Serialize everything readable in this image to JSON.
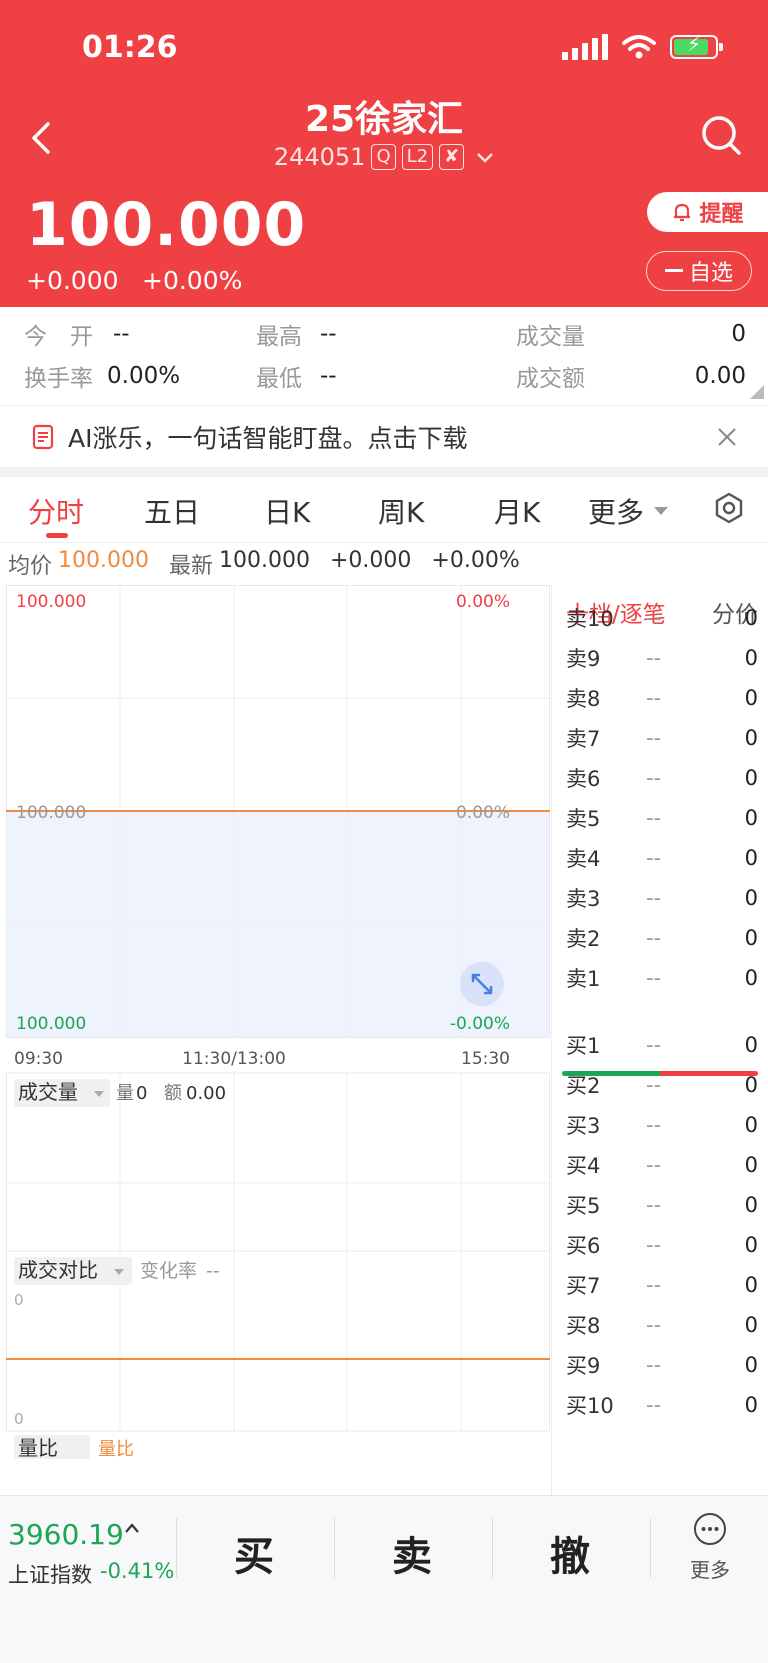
{
  "status": {
    "time": "01:26"
  },
  "stock": {
    "name": "25徐家汇",
    "code": "244051",
    "tag_q": "Q",
    "tag_l2": "L2",
    "tag_x": "✘",
    "price": "100.000",
    "change": "+0.000",
    "change_pct": "+0.00%"
  },
  "header": {
    "remind": "提醒",
    "watchlist": "自选"
  },
  "stats": [
    {
      "label": "今　开",
      "value": "--"
    },
    {
      "label": "最高",
      "value": "--"
    },
    {
      "label": "成交量",
      "value": "0"
    },
    {
      "label": "换手率",
      "value": "0.00%"
    },
    {
      "label": "最低",
      "value": "--"
    },
    {
      "label": "成交额",
      "value": "0.00"
    }
  ],
  "banner": {
    "text": "AI涨乐，一句话智能盯盘。点击下载"
  },
  "tabs": [
    "分时",
    "五日",
    "日K",
    "周K",
    "月K",
    "更多"
  ],
  "quote_line": {
    "avg_label": "均价",
    "avg_value": "100.000",
    "last_label": "最新",
    "last_value": "100.000",
    "change": "+0.000",
    "change_pct": "+0.00%"
  },
  "chart_data": {
    "type": "line",
    "price_axis": {
      "top": "100.000",
      "middle": "100.000",
      "bottom": "100.000"
    },
    "pct_axis": {
      "top": "0.00%",
      "middle": "0.00%",
      "bottom": "-0.00%"
    },
    "time_labels": [
      "09:30",
      "11:30/13:00",
      "15:30"
    ],
    "series": [
      {
        "values": [
          100.0
        ]
      }
    ],
    "ylim": [
      100.0,
      100.0
    ],
    "volume": {
      "selector": "成交量",
      "vol_label": "量",
      "vol_value": "0",
      "amt_label": "额",
      "amt_value": "0.00"
    },
    "ratio": {
      "selector": "成交对比",
      "rate_label": "变化率",
      "rate_value": "--",
      "axis_top": "0",
      "axis_bottom": "0"
    },
    "third_panel": {
      "selector": "量比",
      "label": "量比"
    },
    "colors": {
      "line": "#f08a3c",
      "area": "#eef3fd",
      "up": "#ef4044",
      "down": "#1aa655"
    }
  },
  "orderbook": {
    "tab_active": "十档/逐笔",
    "tab_other": "分价",
    "sell": [
      {
        "label": "卖10",
        "price": "--",
        "vol": "0"
      },
      {
        "label": "卖9",
        "price": "--",
        "vol": "0"
      },
      {
        "label": "卖8",
        "price": "--",
        "vol": "0"
      },
      {
        "label": "卖7",
        "price": "--",
        "vol": "0"
      },
      {
        "label": "卖6",
        "price": "--",
        "vol": "0"
      },
      {
        "label": "卖5",
        "price": "--",
        "vol": "0"
      },
      {
        "label": "卖4",
        "price": "--",
        "vol": "0"
      },
      {
        "label": "卖3",
        "price": "--",
        "vol": "0"
      },
      {
        "label": "卖2",
        "price": "--",
        "vol": "0"
      },
      {
        "label": "卖1",
        "price": "--",
        "vol": "0"
      }
    ],
    "buy": [
      {
        "label": "买1",
        "price": "--",
        "vol": "0"
      },
      {
        "label": "买2",
        "price": "--",
        "vol": "0"
      },
      {
        "label": "买3",
        "price": "--",
        "vol": "0"
      },
      {
        "label": "买4",
        "price": "--",
        "vol": "0"
      },
      {
        "label": "买5",
        "price": "--",
        "vol": "0"
      },
      {
        "label": "买6",
        "price": "--",
        "vol": "0"
      },
      {
        "label": "买7",
        "price": "--",
        "vol": "0"
      },
      {
        "label": "买8",
        "price": "--",
        "vol": "0"
      },
      {
        "label": "买9",
        "price": "--",
        "vol": "0"
      },
      {
        "label": "买10",
        "price": "--",
        "vol": "0"
      }
    ]
  },
  "bottom": {
    "index_value": "3960.19",
    "index_name": "上证指数",
    "index_change": "-0.41%",
    "buy": "买",
    "sell": "卖",
    "cancel": "撤",
    "more": "更多"
  },
  "icons": [
    "back-icon",
    "search-icon",
    "bell-icon",
    "minus-icon",
    "document-icon",
    "close-icon",
    "gear-icon",
    "expand-icon",
    "more-icon",
    "wifi-icon",
    "battery-icon",
    "signal-icon"
  ]
}
